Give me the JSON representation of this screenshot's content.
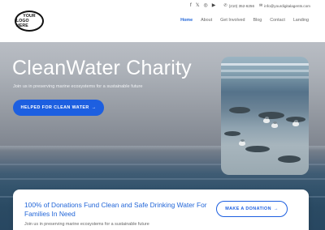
{
  "header": {
    "logo_line1": "YOUR",
    "logo_line2": "LOGO HERE",
    "social": [
      {
        "icon": "facebook-icon",
        "glyph": "f"
      },
      {
        "icon": "x-icon",
        "glyph": "𝕏"
      },
      {
        "icon": "instagram-icon",
        "glyph": "◎"
      },
      {
        "icon": "youtube-icon",
        "glyph": "▶"
      }
    ],
    "phone": "(210) 352-6256",
    "email": "info@yourdigitalagents.com",
    "nav": [
      "Home",
      "About",
      "Get Involved",
      "Blog",
      "Contact",
      "Landing"
    ],
    "active_nav": "Home"
  },
  "hero": {
    "title": "CleanWater Charity",
    "subtitle": "Join us in preserving marine ecosystems for a sustainable future",
    "button_label": "HELPED FOR CLEAN WATER",
    "button_arrow": "→"
  },
  "card": {
    "title": "100% of Donations Fund Clean and Safe Drinking Water For Families In Need",
    "subtitle": "Join us in preserving marine ecosystems for a sustainable future",
    "button_label": "MAKE A DONATION",
    "button_arrow": "→"
  },
  "colors": {
    "accent": "#1d5fe0",
    "link_active": "#2266d8"
  }
}
